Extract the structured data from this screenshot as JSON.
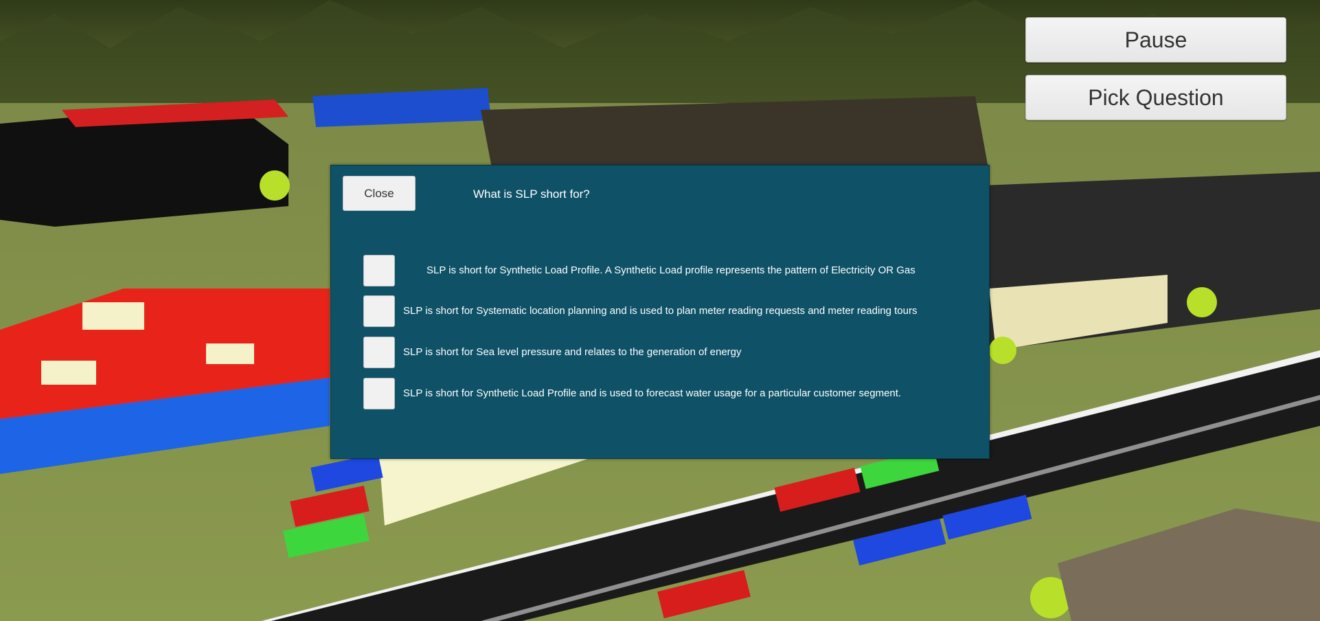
{
  "hud": {
    "pause_label": "Pause",
    "pick_question_label": "Pick Question"
  },
  "quiz": {
    "close_label": "Close",
    "question": "What is SLP short for?",
    "answers": [
      {
        "text": "SLP is short for Synthetic Load Profile. A Synthetic Load profile represents the pattern of Electricity OR Gas",
        "checked": false
      },
      {
        "text": "SLP is short for Systematic location planning and is used to plan meter reading requests and meter reading tours",
        "checked": false
      },
      {
        "text": "SLP is short for Sea level pressure and relates to the generation of energy",
        "checked": false
      },
      {
        "text": "SLP is short for Synthetic Load Profile and is used to forecast water usage for a particular customer segment.",
        "checked": false
      }
    ]
  },
  "colors": {
    "panel_background": "#0f5268",
    "button_background": "#f0f0f0",
    "answer_text": "#ffffff"
  }
}
